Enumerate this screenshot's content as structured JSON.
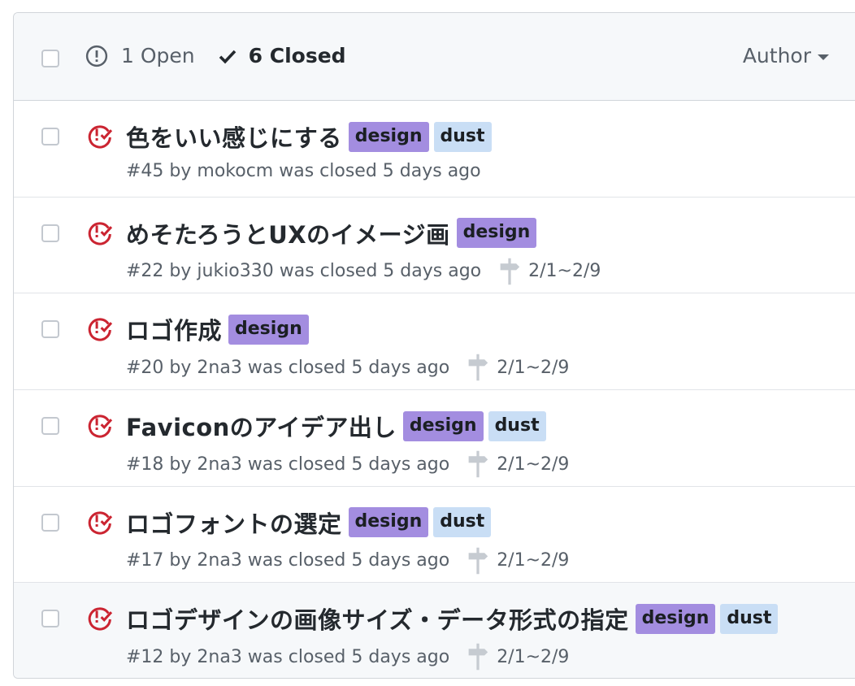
{
  "header": {
    "open_label": "1 Open",
    "closed_label": "6 Closed",
    "author_label": "Author"
  },
  "issues": [
    {
      "title": "色をいい感じにする",
      "labels": [
        "design",
        "dust"
      ],
      "meta": "#45 by mokocm was closed 5 days ago",
      "milestone": ""
    },
    {
      "title": "めそたろうとUXのイメージ画",
      "labels": [
        "design"
      ],
      "meta": "#22 by jukio330 was closed 5 days ago",
      "milestone": "2/1~2/9"
    },
    {
      "title": "ロゴ作成",
      "labels": [
        "design"
      ],
      "meta": "#20 by 2na3 was closed 5 days ago",
      "milestone": "2/1~2/9"
    },
    {
      "title": "Faviconのアイデア出し",
      "labels": [
        "design",
        "dust"
      ],
      "meta": "#18 by 2na3 was closed 5 days ago",
      "milestone": "2/1~2/9"
    },
    {
      "title": "ロゴフォントの選定",
      "labels": [
        "design",
        "dust"
      ],
      "meta": "#17 by 2na3 was closed 5 days ago",
      "milestone": "2/1~2/9"
    },
    {
      "title": "ロゴデザインの画像サイズ・データ形式の指定",
      "labels": [
        "design",
        "dust"
      ],
      "meta": "#12 by 2na3 was closed 5 days ago",
      "milestone": "2/1~2/9"
    }
  ],
  "colors": {
    "design_label": "#a38de0",
    "dust_label": "#c9def5",
    "closed_icon": "#cb2431"
  },
  "icons": {
    "open": "issue-opened-icon",
    "closed": "check-icon",
    "issue_closed": "issue-closed-icon",
    "milestone": "milestone-icon"
  }
}
